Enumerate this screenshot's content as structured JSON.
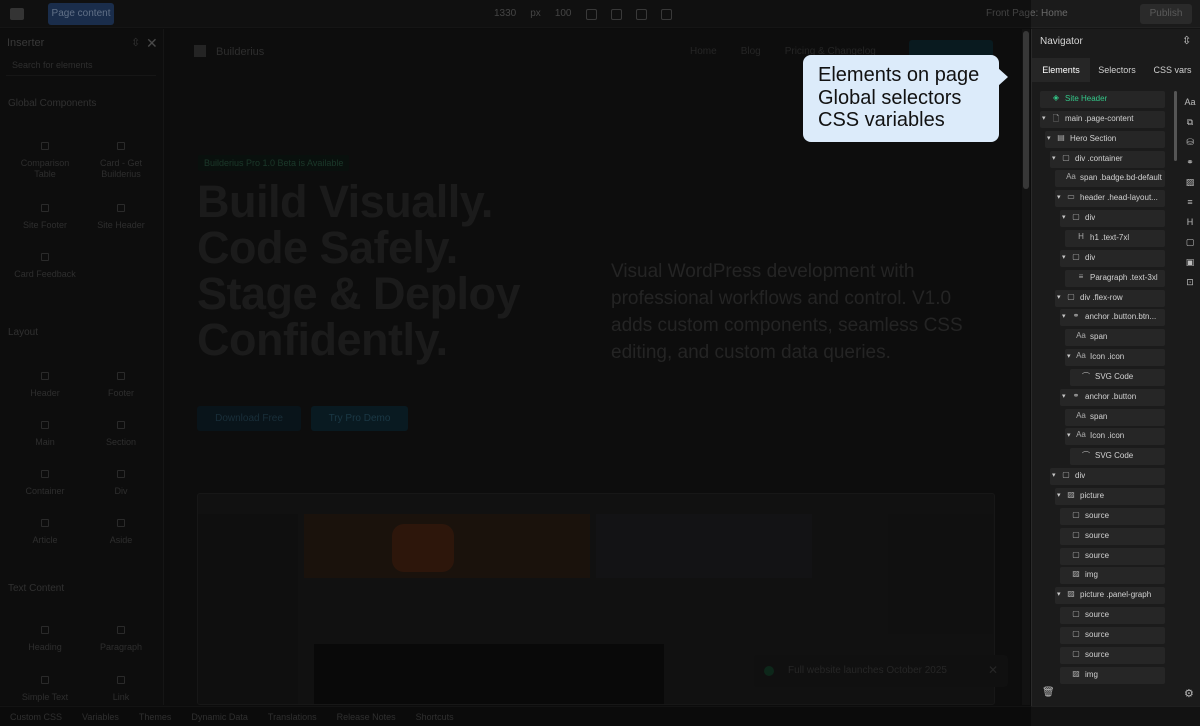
{
  "topbar": {
    "badge": "Page content",
    "width": "1330",
    "unit": "px",
    "zoom": "100",
    "page": "Front Page: Home",
    "publish": "Publish"
  },
  "inserter": {
    "title": "Inserter",
    "search_placeholder": "Search for elements",
    "sections": [
      {
        "title": "Global Components",
        "items": [
          "Comparison Table",
          "Card - Get Builderius",
          "Site Footer",
          "Site Header",
          "Card Feedback"
        ]
      },
      {
        "title": "Layout",
        "items": [
          "Header",
          "Footer",
          "Main",
          "Section",
          "Container",
          "Div",
          "Article",
          "Aside"
        ]
      },
      {
        "title": "Text Content",
        "items": [
          "Heading",
          "Paragraph",
          "Simple Text",
          "Link"
        ]
      }
    ]
  },
  "canvas": {
    "brand": "Builderius",
    "nav": [
      "Home",
      "Blog",
      "Pricing & Changelog"
    ],
    "badge": "Builderius Pro 1.0 Beta is Available",
    "headline": [
      "Build Visually.",
      "Code Safely.",
      "Stage & Deploy",
      "Confidently."
    ],
    "paragraph": "Visual WordPress development with professional workflows and control. V1.0 adds custom components, seamless CSS editing, and custom data queries.",
    "btn_download": "Download Free",
    "btn_try": "Try Pro Demo",
    "toast": "Full website launches October 2025"
  },
  "statusbar": [
    "Custom CSS",
    "Variables",
    "Themes",
    "Dynamic Data",
    "Translations",
    "Release Notes",
    "Shortcuts"
  ],
  "callout": {
    "lines": [
      "Elements on page",
      "Global selectors",
      "CSS variables"
    ]
  },
  "navigator": {
    "title": "Navigator",
    "tabs": [
      "Elements",
      "Selectors",
      "CSS vars"
    ],
    "active_tab": "Elements",
    "tree": [
      {
        "label": "Site Header",
        "icon": "component-icon",
        "level": 0,
        "caret": false,
        "highlight": true
      },
      {
        "label": "main .page-content",
        "icon": "page-icon",
        "level": 0,
        "caret": true
      },
      {
        "label": "Hero Section",
        "icon": "section-icon",
        "level": 1,
        "caret": true
      },
      {
        "label": "div .container",
        "icon": "box-icon",
        "level": 2,
        "caret": true
      },
      {
        "label": "span .badge.bd-default",
        "icon": "text-icon",
        "level": 3,
        "caret": false
      },
      {
        "label": "header .head-layout...",
        "icon": "header-icon",
        "level": 3,
        "caret": true
      },
      {
        "label": "div",
        "icon": "box-icon",
        "level": 4,
        "caret": true
      },
      {
        "label": "h1 .text-7xl",
        "icon": "heading-icon",
        "level": 5,
        "caret": false
      },
      {
        "label": "div",
        "icon": "box-icon",
        "level": 4,
        "caret": true
      },
      {
        "label": "Paragraph .text-3xl",
        "icon": "paragraph-icon",
        "level": 5,
        "caret": false
      },
      {
        "label": "div .flex-row",
        "icon": "box-icon",
        "level": 3,
        "caret": true
      },
      {
        "label": "anchor .button.btn...",
        "icon": "link-icon",
        "level": 4,
        "caret": true
      },
      {
        "label": "span",
        "icon": "text-icon",
        "level": 5,
        "caret": false
      },
      {
        "label": "Icon .icon",
        "icon": "text-icon",
        "level": 5,
        "caret": true
      },
      {
        "label": "SVG Code",
        "icon": "svg-icon",
        "level": 6,
        "caret": false
      },
      {
        "label": "anchor .button",
        "icon": "link-icon",
        "level": 4,
        "caret": true
      },
      {
        "label": "span",
        "icon": "text-icon",
        "level": 5,
        "caret": false
      },
      {
        "label": "Icon .icon",
        "icon": "text-icon",
        "level": 5,
        "caret": true
      },
      {
        "label": "SVG Code",
        "icon": "svg-icon",
        "level": 6,
        "caret": false
      },
      {
        "label": "div",
        "icon": "box-icon",
        "level": 2,
        "caret": true
      },
      {
        "label": "picture",
        "icon": "image-icon",
        "level": 3,
        "caret": true
      },
      {
        "label": "source",
        "icon": "box-icon",
        "level": 4,
        "caret": false
      },
      {
        "label": "source",
        "icon": "box-icon",
        "level": 4,
        "caret": false
      },
      {
        "label": "source",
        "icon": "box-icon",
        "level": 4,
        "caret": false
      },
      {
        "label": "img",
        "icon": "image-icon",
        "level": 4,
        "caret": false
      },
      {
        "label": "picture .panel-graph",
        "icon": "image-icon",
        "level": 3,
        "caret": true
      },
      {
        "label": "source",
        "icon": "box-icon",
        "level": 4,
        "caret": false
      },
      {
        "label": "source",
        "icon": "box-icon",
        "level": 4,
        "caret": false
      },
      {
        "label": "source",
        "icon": "box-icon",
        "level": 4,
        "caret": false
      },
      {
        "label": "img",
        "icon": "image-icon",
        "level": 4,
        "caret": false
      }
    ]
  },
  "colors": {
    "accent_green": "#34c98a",
    "callout_bg": "#dcebfa",
    "panel_bg": "#1b1b1b"
  }
}
